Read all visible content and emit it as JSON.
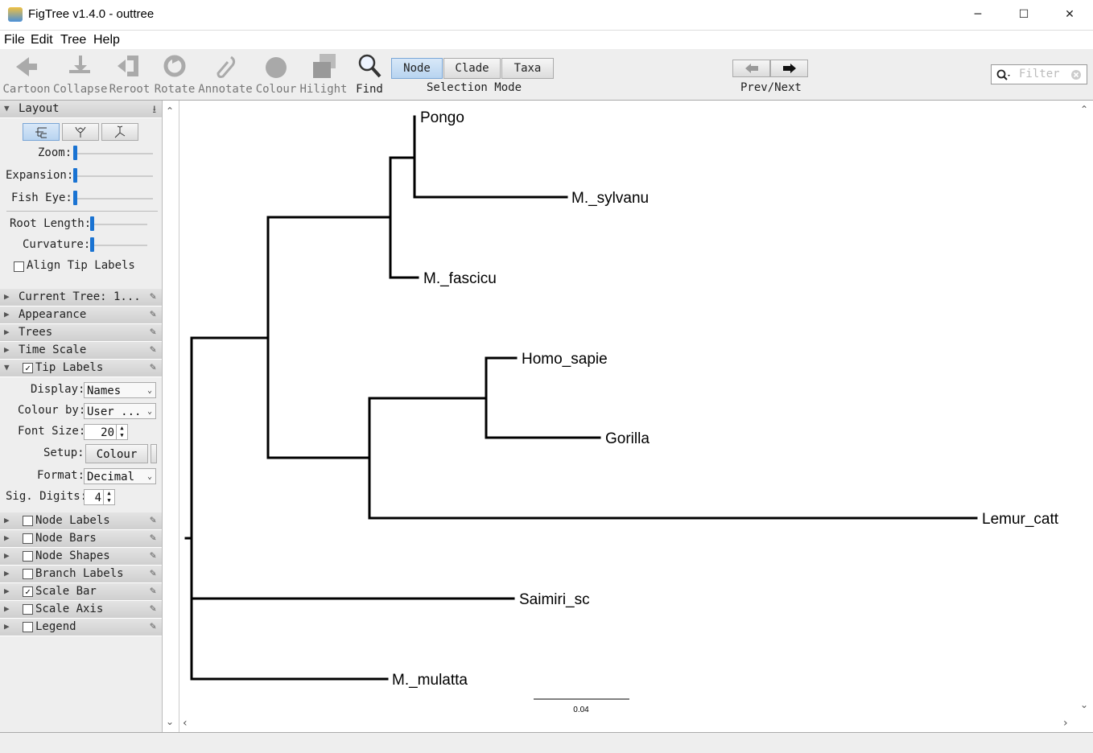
{
  "window": {
    "title": "FigTree v1.4.0 - outtree",
    "minimize": "─",
    "maximize": "☐",
    "close": "✕"
  },
  "menu": [
    "File",
    "Edit",
    "Tree",
    "Help"
  ],
  "toolbar": {
    "tools": [
      {
        "label": "Cartoon",
        "icon": "cartoon-icon"
      },
      {
        "label": "Collapse",
        "icon": "collapse-icon"
      },
      {
        "label": "Reroot",
        "icon": "reroot-icon"
      },
      {
        "label": "Rotate",
        "icon": "rotate-icon"
      },
      {
        "label": "Annotate",
        "icon": "annotate-icon"
      },
      {
        "label": "Colour",
        "icon": "colour-icon"
      },
      {
        "label": "Hilight",
        "icon": "hilight-icon"
      },
      {
        "label": "Find",
        "icon": "find-icon"
      }
    ],
    "selection_modes": [
      "Node",
      "Clade",
      "Taxa"
    ],
    "selected_mode": "Node",
    "selection_mode_label": "Selection Mode",
    "prev_next_label": "Prev/Next",
    "filter_placeholder": "Filter"
  },
  "sidebar": {
    "layout": {
      "header": "Layout",
      "zoom_label": "Zoom:",
      "expansion_label": "Expansion:",
      "fisheye_label": "Fish Eye:",
      "root_length_label": "Root Length:",
      "curvature_label": "Curvature:",
      "align_tip_labels": "Align Tip Labels",
      "align_checked": false
    },
    "sections": [
      {
        "label": "Current Tree: 1...",
        "checkbox": null
      },
      {
        "label": "Appearance",
        "checkbox": null
      },
      {
        "label": "Trees",
        "checkbox": null
      },
      {
        "label": "Time Scale",
        "checkbox": null
      }
    ],
    "tip_labels": {
      "header": "Tip Labels",
      "checked": true,
      "display_label": "Display:",
      "display_value": "Names",
      "colour_by_label": "Colour by:",
      "colour_by_value": "User ...",
      "font_size_label": "Font Size:",
      "font_size_value": "20",
      "setup_label": "Setup:",
      "setup_button": "Colour",
      "format_label": "Format:",
      "format_value": "Decimal",
      "sig_digits_label": "Sig. Digits:",
      "sig_digits_value": "4"
    },
    "checked_sections": [
      {
        "label": "Node Labels",
        "checked": false
      },
      {
        "label": "Node Bars",
        "checked": false
      },
      {
        "label": "Node Shapes",
        "checked": false
      },
      {
        "label": "Branch Labels",
        "checked": false
      },
      {
        "label": "Scale Bar",
        "checked": true
      },
      {
        "label": "Scale Axis",
        "checked": false
      },
      {
        "label": "Legend",
        "checked": false
      }
    ]
  },
  "tree": {
    "taxa": [
      "Pongo",
      "M._sylvanu",
      "M._fascicu",
      "Homo_sapie",
      "Gorilla",
      "Lemur_catt",
      "Saimiri_sc",
      "M._mulatta"
    ],
    "scale_bar_label": "0.04"
  },
  "colors": {
    "accent": "#1a73d2",
    "selected_mode_bg": "#b8d4f0"
  }
}
